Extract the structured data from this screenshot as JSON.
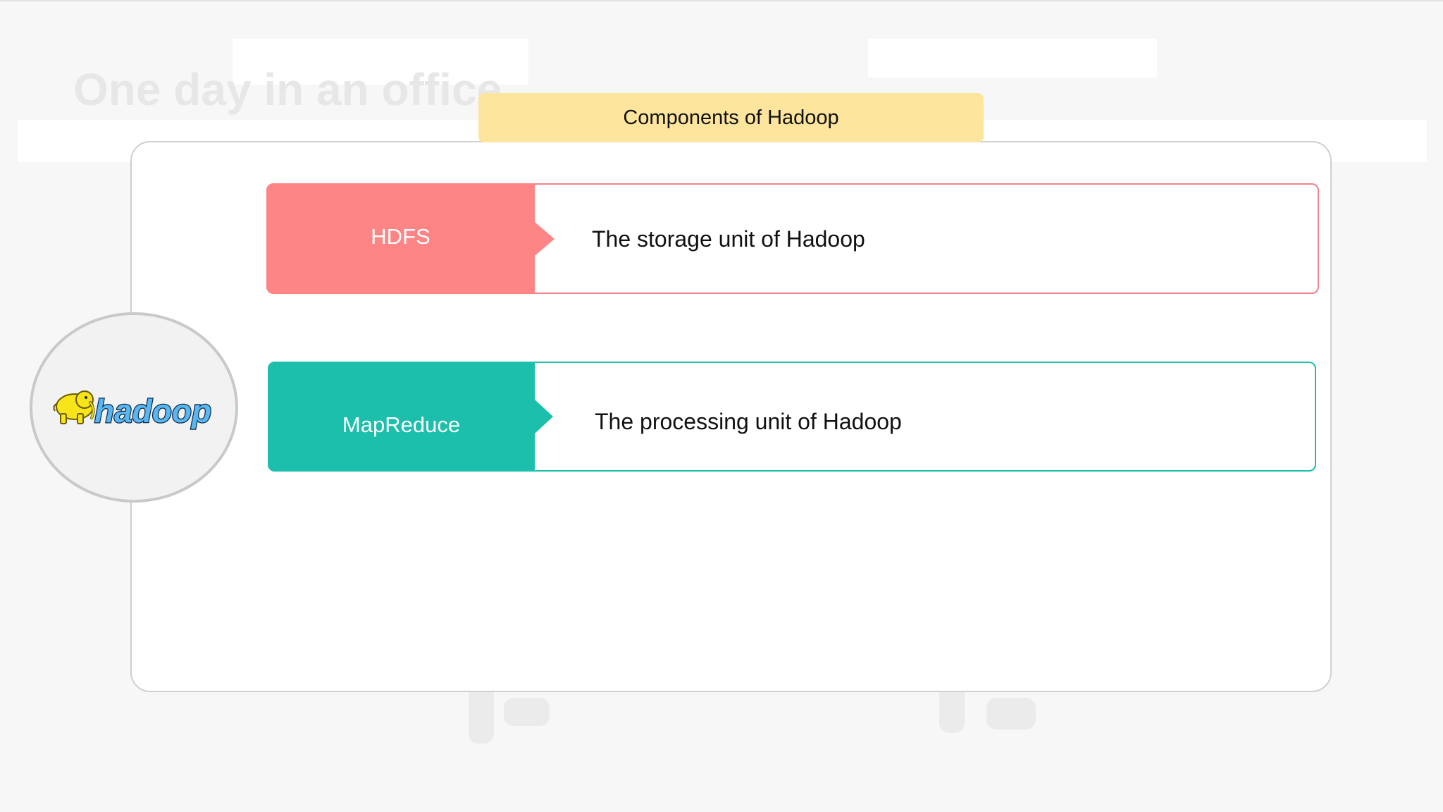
{
  "background": {
    "title": "One day in an office"
  },
  "banner": {
    "title": "Components of Hadoop"
  },
  "components": [
    {
      "name": "HDFS",
      "description": "The storage unit of Hadoop",
      "color": "#fe8585"
    },
    {
      "name": "MapReduce",
      "description": "The processing unit of Hadoop",
      "color": "#1bbfab"
    }
  ],
  "logo": {
    "wordmark": "hadoop",
    "icon": "elephant-icon"
  },
  "colors": {
    "banner": "#fde59d",
    "card_border": "#cfcfcf"
  }
}
